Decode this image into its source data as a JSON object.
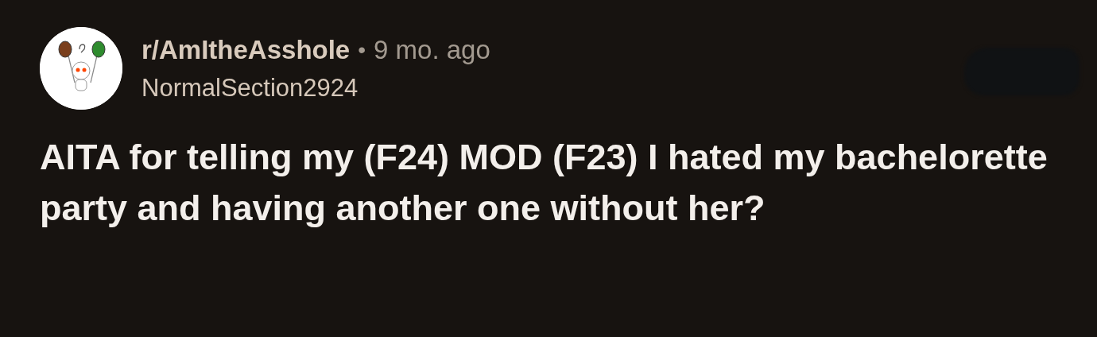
{
  "post": {
    "subreddit": "r/AmItheAsshole",
    "separator": "•",
    "time": "9 mo. ago",
    "author": "NormalSection2924",
    "title": "AITA for telling my (F24) MOD (F23) I hated my bachelorette party and having another one without her?"
  }
}
